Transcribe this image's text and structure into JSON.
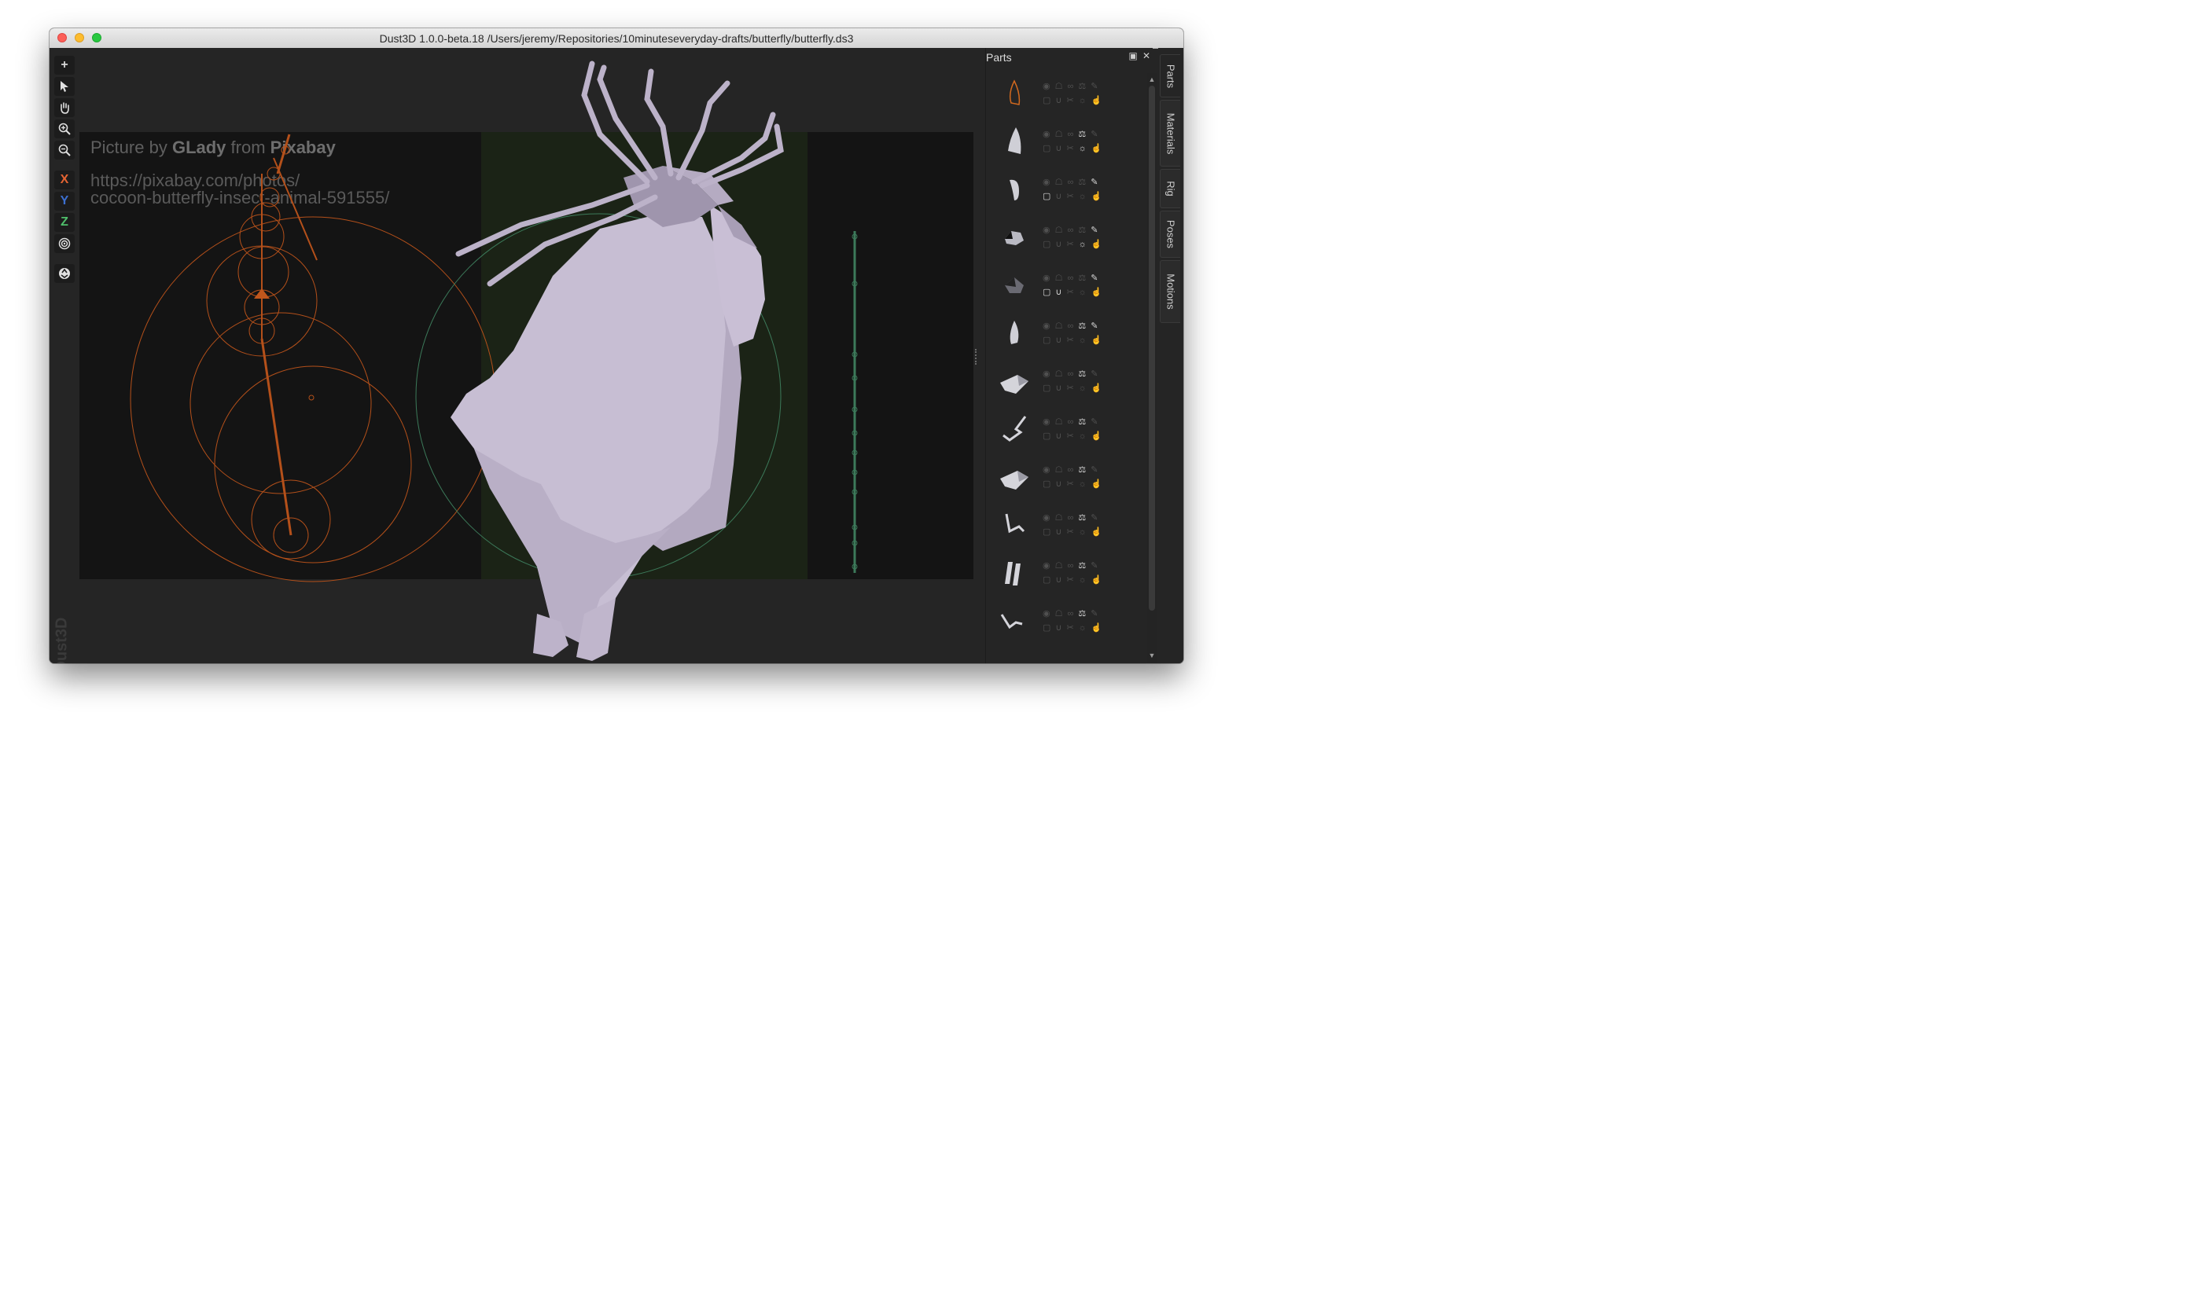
{
  "window": {
    "title": "Dust3D 1.0.0-beta.18 /Users/jeremy/Repositories/10minuteseveryday-drafts/butterfly/butterfly.ds3"
  },
  "toolbar": {
    "add_icon": "plus-icon",
    "select_icon": "arrow-pointer-icon",
    "drag_icon": "hand-icon",
    "zoom_in_icon": "zoom-in-icon",
    "zoom_out_icon": "zoom-out-icon",
    "x_label": "X",
    "y_label": "Y",
    "z_label": "Z",
    "radius_icon": "target-icon",
    "regenerate_icon": "recycle-icon"
  },
  "reference_image": {
    "credit_prefix": "Picture by",
    "credit_author": "GLady",
    "credit_mid": "from",
    "credit_site": "Pixabay",
    "url_line1": "https://pixabay.com/photos/",
    "url_line2": "cocoon-butterfly-insect-animal-591555/"
  },
  "brand": "Dust3D",
  "parts_panel": {
    "title": "Parts",
    "float_icon": "float-window-icon",
    "close_icon": "close-icon",
    "control_icons": [
      "eye-icon",
      "lock-icon",
      "link-icon",
      "mirror-balance-icon",
      "color-picker-icon",
      "checkbox-icon",
      "magnet-icon",
      "scissors-icon",
      "sun-icon",
      "hand-point-icon"
    ],
    "parts": [
      {
        "shape": "outline"
      },
      {
        "shape": "bell"
      },
      {
        "shape": "bean"
      },
      {
        "shape": "rock"
      },
      {
        "shape": "rock-dark"
      },
      {
        "shape": "drop"
      },
      {
        "shape": "wing-flat"
      },
      {
        "shape": "leg"
      },
      {
        "shape": "wing-flat"
      },
      {
        "shape": "leg-short"
      },
      {
        "shape": "twin-bars"
      },
      {
        "shape": "leg-small"
      }
    ]
  },
  "side_tabs": [
    "Parts",
    "Materials",
    "Rig",
    "Poses",
    "Motions"
  ],
  "colors": {
    "x_axis": "#e56432",
    "y_axis": "#3c6fd0",
    "z_axis": "#4fbf6b",
    "model": "#c5bbd0",
    "front_profile": "#c0561c",
    "side_profile": "#3c7a5a"
  }
}
